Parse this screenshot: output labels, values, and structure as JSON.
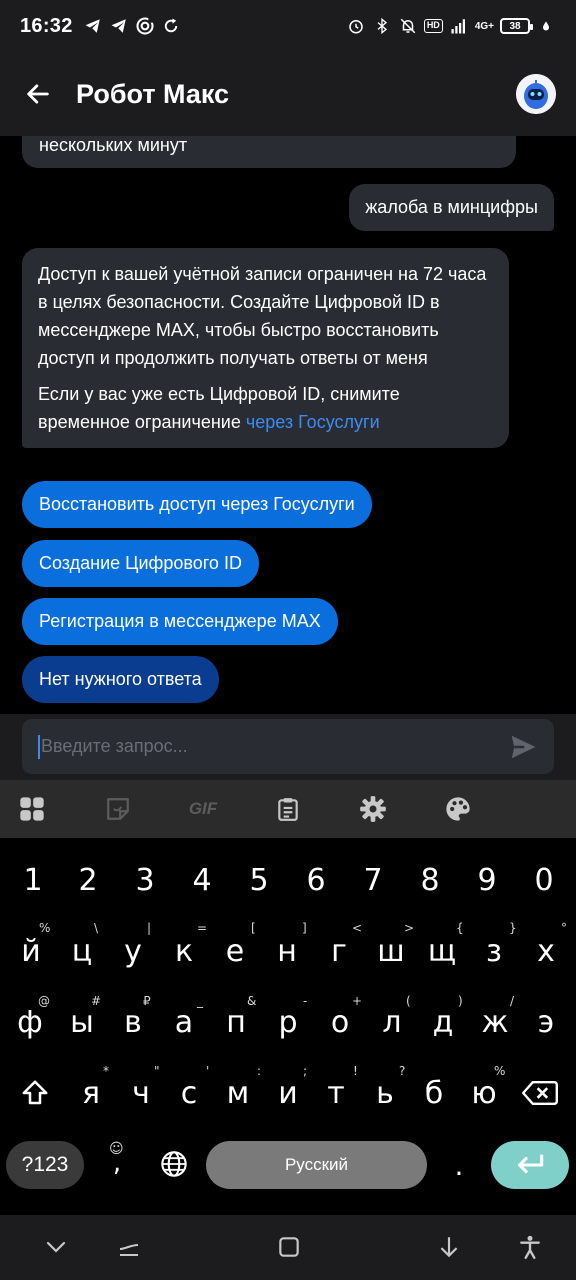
{
  "status_bar": {
    "time": "16:32",
    "battery": "38",
    "network": "4G+",
    "hd": "HD"
  },
  "header": {
    "title": "Робот Макс"
  },
  "chat": {
    "partial_message": "нескольких минут",
    "user_message": "жалоба в минцифры",
    "bot_message_p1": "Доступ к вашей учётной записи ограничен на 72 часа в целях безопасности. Создайте Цифровой ID в мессенджере MAX, чтобы быстро восстановить доступ и продолжить получать ответы от меня",
    "bot_message_p2_text": "Если у вас уже есть Цифровой ID, снимите временное ограничение ",
    "bot_message_p2_link": "через Госуслуги",
    "quick_replies": [
      "Восстановить доступ через Госуслуги",
      "Создание Цифрового ID",
      "Регистрация в мессенджере MAX",
      "Нет нужного ответа"
    ]
  },
  "input": {
    "placeholder": "Введите запрос..."
  },
  "keyboard": {
    "toolbar_icons": [
      "apps-grid-icon",
      "sticker-icon",
      "gif-icon",
      "clipboard-icon",
      "settings-gear-icon",
      "palette-icon"
    ],
    "gif_label": "GIF",
    "row_numbers": [
      "1",
      "2",
      "3",
      "4",
      "5",
      "6",
      "7",
      "8",
      "9",
      "0"
    ],
    "row1": [
      "й",
      "ц",
      "у",
      "к",
      "е",
      "н",
      "г",
      "ш",
      "щ",
      "з",
      "х"
    ],
    "row1_alt": [
      "%",
      "\\",
      "|",
      "=",
      "[",
      "]",
      "<",
      ">",
      "{",
      "}",
      "°"
    ],
    "row2": [
      "ф",
      "ы",
      "в",
      "а",
      "п",
      "р",
      "о",
      "л",
      "д",
      "ж",
      "э"
    ],
    "row2_alt": [
      "@",
      "#",
      "₽",
      "_",
      "&",
      "-",
      "+",
      "(",
      ")",
      "/",
      ""
    ],
    "row3": [
      "я",
      "ч",
      "с",
      "м",
      "и",
      "т",
      "ь",
      "б",
      "ю"
    ],
    "row3_alt": [
      "*",
      "\"",
      "'",
      ":",
      ";",
      "!",
      "?",
      "",
      "%"
    ],
    "mode_key": "?123",
    "comma_key": ",",
    "space_label": "Русский",
    "period_key": "."
  },
  "colors": {
    "accent": "#0a6fdc",
    "accent_dark": "#0a3d8f",
    "link": "#3c8cf0",
    "bubble": "#2a2c34",
    "enter_key": "#7fd0c8"
  }
}
